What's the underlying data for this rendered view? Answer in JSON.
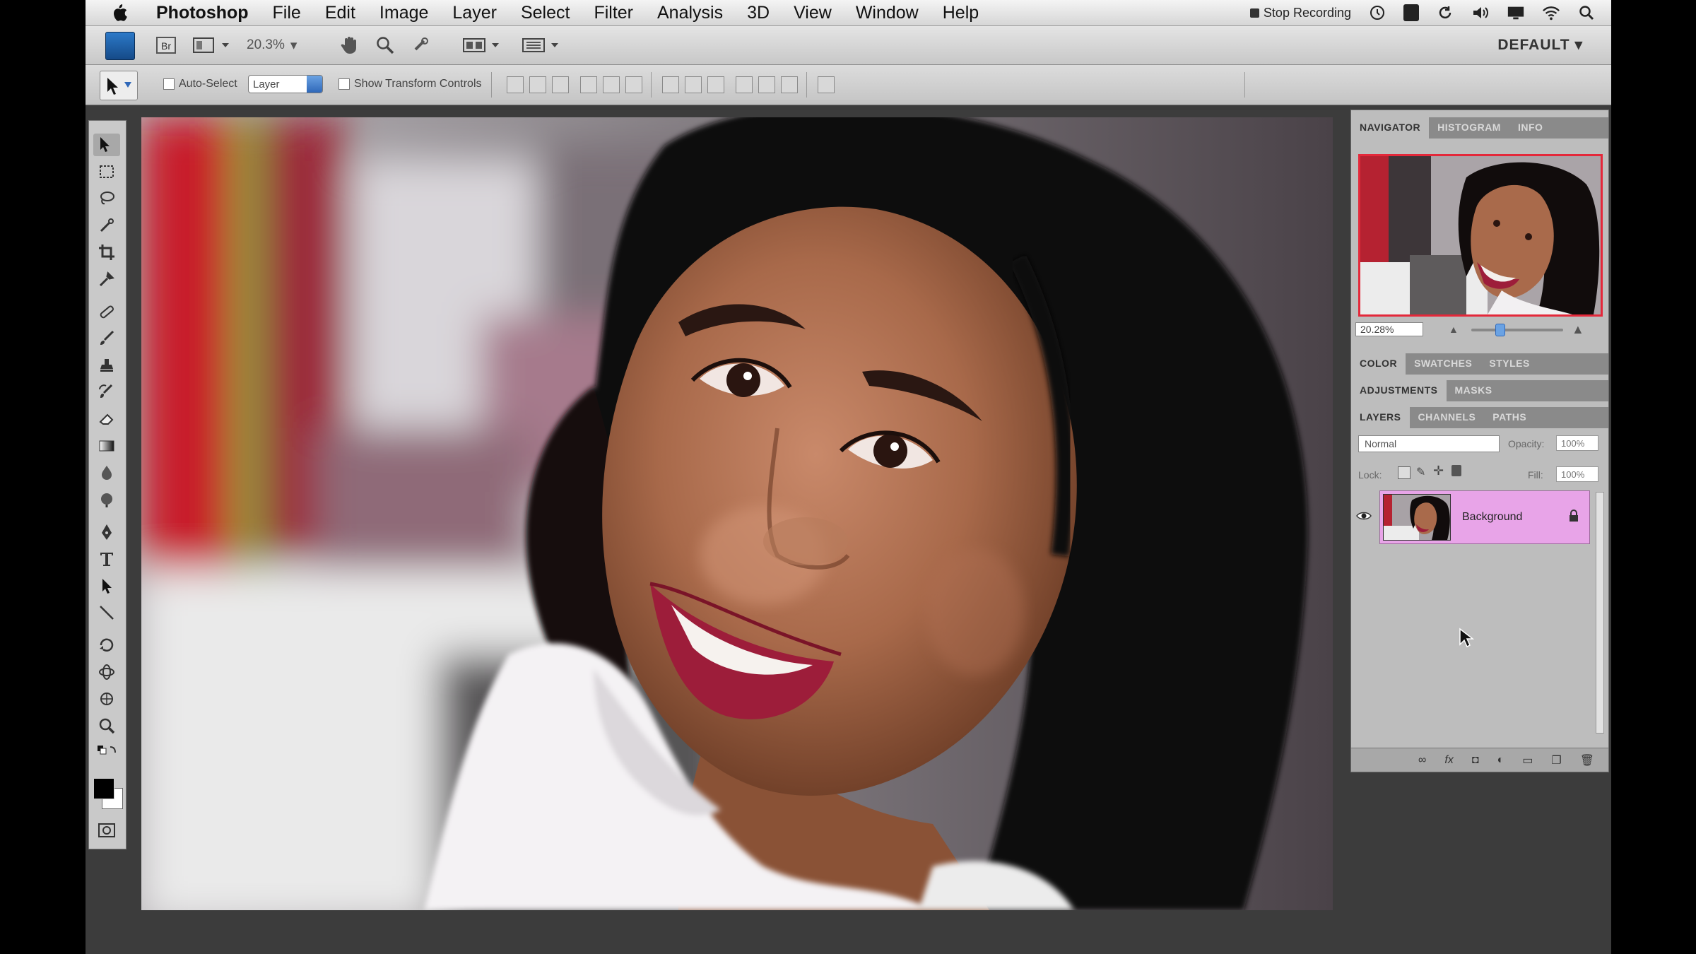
{
  "menubar": {
    "app_name": "Photoshop",
    "items": [
      "File",
      "Edit",
      "Image",
      "Layer",
      "Select",
      "Filter",
      "Analysis",
      "3D",
      "View",
      "Window",
      "Help"
    ],
    "stop_recording": "Stop Recording"
  },
  "appbar": {
    "zoom": "20.3%",
    "workspace": "DEFAULT"
  },
  "options": {
    "auto_select_label": "Auto-Select",
    "auto_select_target": "Layer",
    "show_transform_label": "Show Transform Controls"
  },
  "panels": {
    "group1_tabs": [
      "NAVIGATOR",
      "HISTOGRAM",
      "INFO"
    ],
    "navigator_zoom": "20.28%",
    "navigator_zoom_level": 0.26,
    "group2_tabs": [
      "COLOR",
      "SWATCHES",
      "STYLES"
    ],
    "group3_tabs": [
      "ADJUSTMENTS",
      "MASKS"
    ],
    "group4_tabs": [
      "LAYERS",
      "CHANNELS",
      "PATHS"
    ],
    "blend_mode": "Normal",
    "opacity_label": "Opacity:",
    "opacity_value": "100%",
    "lock_label": "Lock:",
    "fill_label": "Fill:",
    "fill_value": "100%",
    "layer_name": "Background"
  },
  "colors": {
    "layer_selected": "#e8a4e8",
    "navigator_frame": "#e4283a",
    "accent_blue": "#2f68b9"
  }
}
